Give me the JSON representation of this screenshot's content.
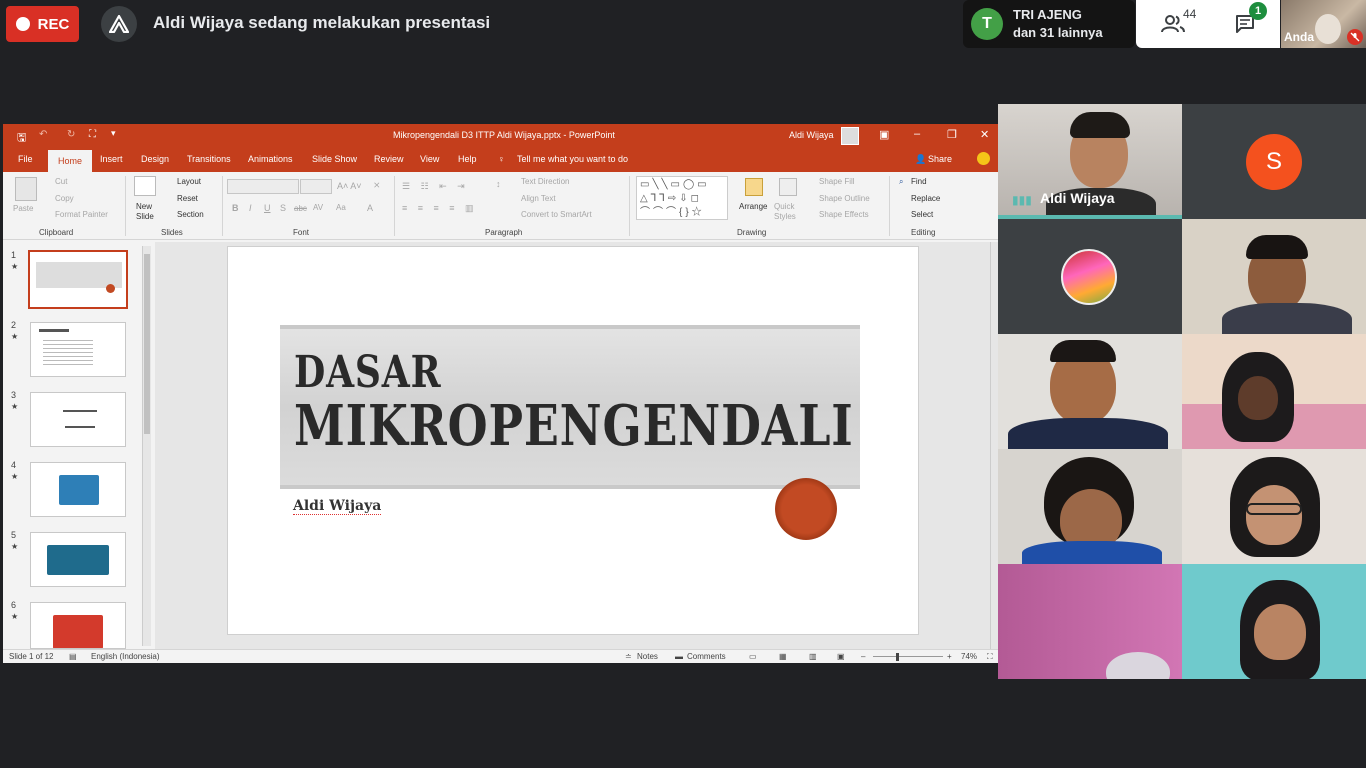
{
  "meet": {
    "rec_label": "REC",
    "presenting_title": "Aldi Wijaya sedang melakukan presentasi",
    "join_avatar_letter": "T",
    "join_name": "TRI AJENG",
    "join_others": "dan 31 lainnya",
    "people_count": "44",
    "chat_badge": "1",
    "self_label": "Anda"
  },
  "ppt": {
    "window_title": "Mikropengendali D3 ITTP Aldi Wijaya.pptx  -  PowerPoint",
    "user_name": "Aldi Wijaya",
    "menu": [
      "File",
      "Home",
      "Insert",
      "Design",
      "Transitions",
      "Animations",
      "Slide Show",
      "Review",
      "View",
      "Help"
    ],
    "tell_me": "Tell me what you want to do",
    "share": "Share",
    "ribbon": {
      "paste": "Paste",
      "cut": "Cut",
      "copy": "Copy",
      "format_painter": "Format Painter",
      "clipboard": "Clipboard",
      "new_slide": "New Slide",
      "layout": "Layout",
      "reset": "Reset",
      "section": "Section",
      "slides": "Slides",
      "font": "Font",
      "bold": "B",
      "italic": "I",
      "underline": "U",
      "shadow": "S",
      "strike": "abc",
      "spacing": "AV",
      "case": "Aa",
      "font_color": "A",
      "text_direction": "Text Direction",
      "align_text": "Align Text",
      "convert_smartart": "Convert to SmartArt",
      "paragraph": "Paragraph",
      "arrange": "Arrange",
      "quick_styles": "Quick Styles",
      "shape_fill": "Shape Fill",
      "shape_outline": "Shape Outline",
      "shape_effects": "Shape Effects",
      "drawing": "Drawing",
      "find": "Find",
      "replace": "Replace",
      "select": "Select",
      "editing": "Editing"
    },
    "thumbs": [
      {
        "num": "1",
        "star": "★"
      },
      {
        "num": "2",
        "star": "★"
      },
      {
        "num": "3",
        "star": "★"
      },
      {
        "num": "4",
        "star": "★"
      },
      {
        "num": "5",
        "star": "★"
      },
      {
        "num": "6",
        "star": "★"
      }
    ],
    "slide": {
      "title_line1": "DASAR",
      "title_line2": "MIKROPENGENDALI",
      "author": "Aldi Wijaya"
    },
    "status": {
      "slide_of": "Slide 1 of 12",
      "language": "English (Indonesia)",
      "notes": "Notes",
      "comments": "Comments",
      "zoom": "74%"
    }
  },
  "participants": {
    "presenter_name": "Aldi Wijaya",
    "avatar_letter": "S"
  },
  "colors": {
    "rec": "#d93025",
    "ppt_accent": "#c43e1c",
    "join_avatar": "#43a047",
    "avatar_s": "#f4511e",
    "speaking": "#5bb9b0"
  }
}
